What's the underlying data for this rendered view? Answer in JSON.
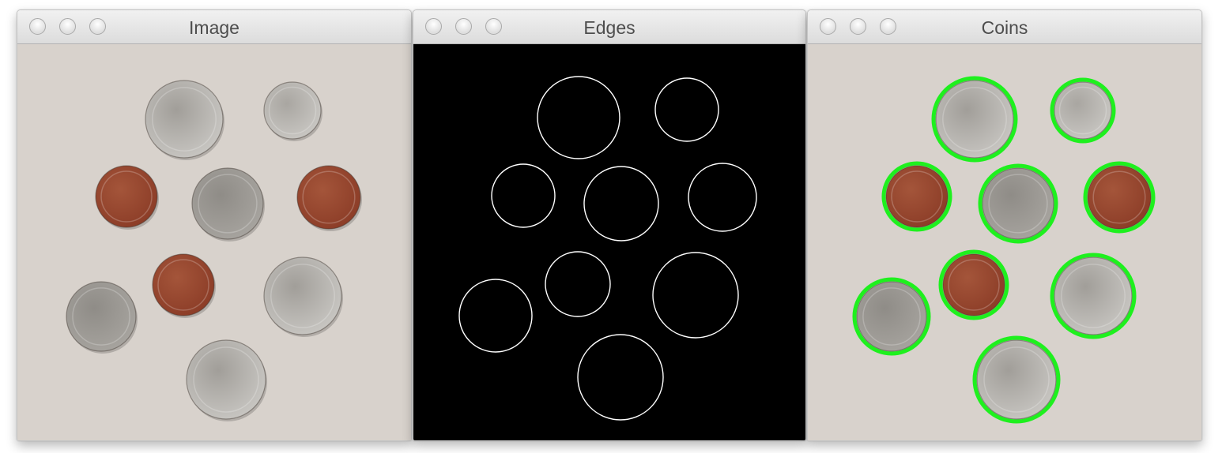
{
  "windows": [
    {
      "id": "image",
      "title": "Image",
      "view": "photo"
    },
    {
      "id": "edges",
      "title": "Edges",
      "view": "edges"
    },
    {
      "id": "coins",
      "title": "Coins",
      "view": "detected"
    }
  ],
  "colors": {
    "photo_background": "#d8d2cc",
    "edges_background": "#000000",
    "edge_line": "#ffffff",
    "detection_circle": "#1ef01e",
    "penny": "#8a3b26",
    "silver": "#a8a5a0",
    "silver_light": "#cac8c4"
  },
  "coins": [
    {
      "type": "quarter"
    },
    {
      "type": "dime"
    },
    {
      "type": "penny"
    },
    {
      "type": "nickel"
    },
    {
      "type": "penny"
    },
    {
      "type": "penny"
    },
    {
      "type": "quarter"
    },
    {
      "type": "nickel"
    },
    {
      "type": "quarter"
    }
  ]
}
